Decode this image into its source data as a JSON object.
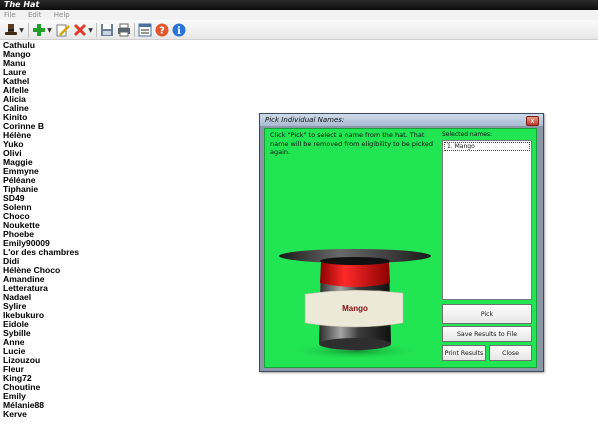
{
  "window": {
    "title": "The Hat"
  },
  "menu": {
    "items": [
      "File",
      "Edit",
      "Help"
    ]
  },
  "toolbar": {
    "icons": [
      "hat-icon",
      "add-icon",
      "edit-icon",
      "delete-icon",
      "save-icon",
      "print-icon",
      "list-icon",
      "help-icon",
      "info-icon"
    ]
  },
  "names": [
    "Cathulu",
    "Mango",
    "Manu",
    "Laure",
    "Kathel",
    "Aifelle",
    "Alicia",
    "Caline",
    "Kinito",
    "Corinne B",
    "Hélène",
    "Yuko",
    "Olivi",
    "Maggie",
    "Emmyne",
    "Péléane",
    "Tiphanie",
    "SD49",
    "Solenn",
    "Choco",
    "Noukette",
    "Phoebe",
    "Emily90009",
    "L'or des chambres",
    "Didi",
    "Hélène Choco",
    "Amandine",
    "Letteratura",
    "Nadael",
    "Sylire",
    "Ikebukuro",
    "Eidole",
    "Sybille",
    "Anne",
    "Lucie",
    "Lizouzou",
    "Fleur",
    "King72",
    "Choutine",
    "Emily",
    "Mélanie88",
    "Kerve"
  ],
  "dialog": {
    "title": "Pick Individual Names:",
    "close_label": "x",
    "instructions": "Click \"Pick\" to select a name from the hat. That name will be removed from eligibility to be picked again.",
    "selected_label": "Selected names:",
    "selected": [
      "1. Mango"
    ],
    "hat_name": "Mango",
    "buttons": {
      "pick": "Pick",
      "save": "Save Results to File",
      "print": "Print Results",
      "close": "Close"
    }
  },
  "colors": {
    "dialog_green": "#22e553",
    "hat_band": "#e8e6d8",
    "hat_red": "#d80c0c"
  }
}
